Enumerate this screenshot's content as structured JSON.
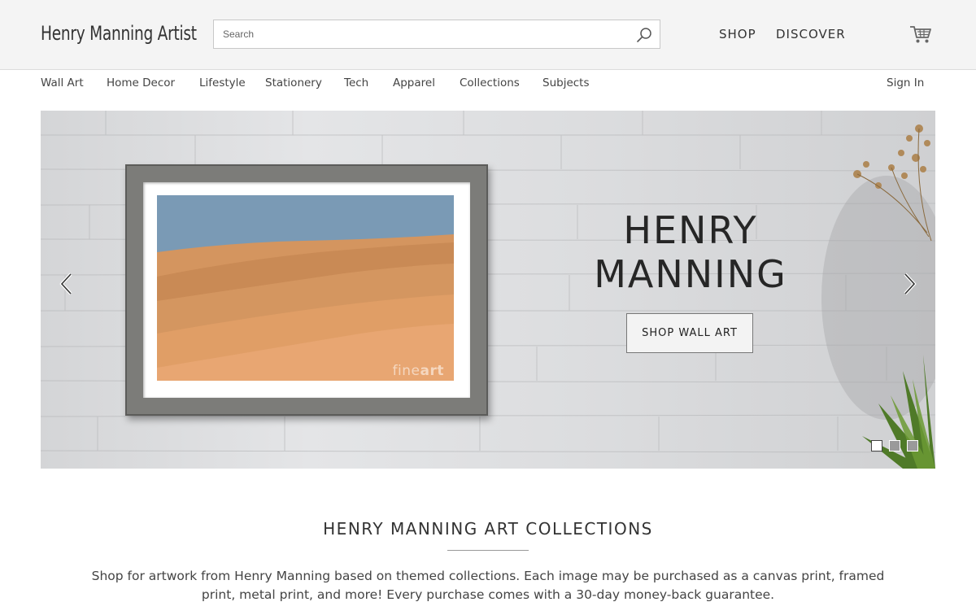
{
  "header": {
    "logo": "Henry Manning Artist",
    "search_placeholder": "Search",
    "nav": [
      "SHOP",
      "DISCOVER"
    ]
  },
  "categories": [
    "Wall Art",
    "Home Decor",
    "Lifestyle",
    "Stationery",
    "Tech",
    "Apparel",
    "Collections",
    "Subjects"
  ],
  "account": {
    "sign_in": "Sign In"
  },
  "hero": {
    "title_line1": "HENRY",
    "title_line2": "MANNING",
    "cta": "SHOP WALL ART",
    "watermark_light": "fine",
    "watermark_bold": "art",
    "slides": 3,
    "active_slide": 1
  },
  "collections": {
    "title": "HENRY MANNING ART COLLECTIONS",
    "description": "Shop for artwork from Henry Manning based on themed collections. Each image may be purchased as a canvas print, framed print, metal print, and more! Every purchase comes with a 30-day money-back guarantee."
  },
  "colors": {
    "header_bg": "#f4f4f4",
    "art_sky": "#7a9ab5",
    "art_sand_dark": "#c98a55",
    "art_sand_light": "#e8a672"
  },
  "icons": [
    "search-icon",
    "cart-icon",
    "chevron-left-icon",
    "chevron-right-icon"
  ]
}
